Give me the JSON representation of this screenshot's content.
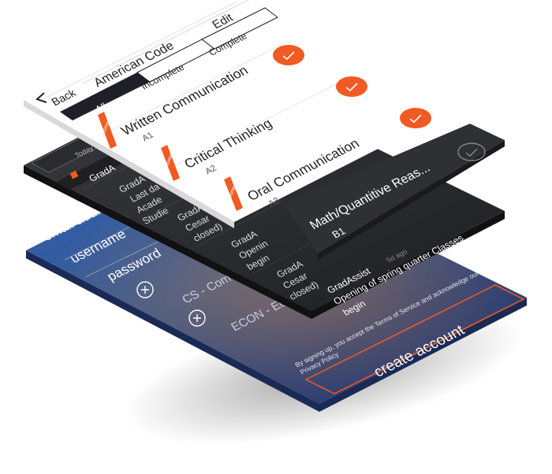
{
  "colors": {
    "accent": "#f15a22",
    "list_bg": "#ffffff",
    "dark_panel": "#2e2f33",
    "signup_blue": "#1f4f9c"
  },
  "top_screen": {
    "back_label": "Back",
    "title": "American Code",
    "edit_label": "Edit",
    "tabs": [
      "All",
      "Incomplete",
      "Complete"
    ],
    "items": [
      {
        "title": "Written Communication",
        "code": "A1",
        "badge": "complete"
      },
      {
        "title": "Critical Thinking",
        "code": "A2",
        "badge": "complete"
      },
      {
        "title": "Oral Communication",
        "code": "A3",
        "badge": "complete"
      }
    ],
    "dark_item": {
      "title": "Math/Quantitive Reas...",
      "code": "B1"
    }
  },
  "middle_screen": {
    "today_label": "Today",
    "header_item": "GradA",
    "feed": [
      {
        "author": "GradA",
        "line1": "Last da",
        "line2": "Acade",
        "line3": "Studie"
      },
      {
        "author": "GradA",
        "line1": "Cesar",
        "line2": "closed)"
      },
      {
        "author": "GradA",
        "line1": "Openin",
        "line2": "begin"
      },
      {
        "author": "GradA",
        "line1": "Cesar",
        "line2": "closed)"
      },
      {
        "author": "GradAssist",
        "time": "5d ago",
        "line1": "Opening of spring quarter Classes",
        "line2": "begin"
      }
    ]
  },
  "bottom_screen": {
    "field_email": "email addr",
    "field_username": "username",
    "field_password": "password",
    "courses": [
      "CS - Com",
      "ECON - Ec"
    ],
    "terms_text": "By signing up, you accept the Terms of Service and acknowledge our Privacy Policy",
    "create_label": "create account"
  }
}
